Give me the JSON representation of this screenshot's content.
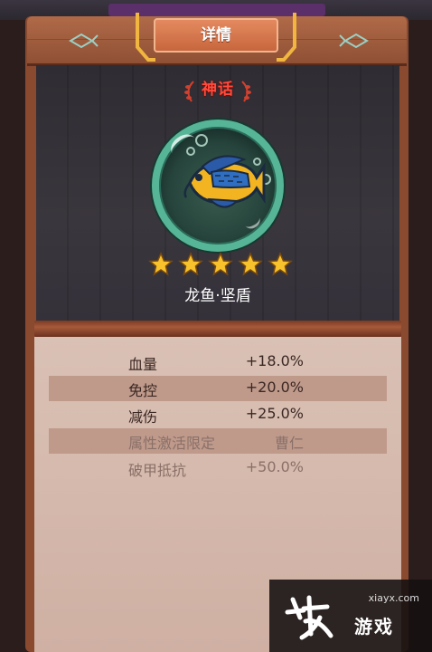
{
  "header": {
    "title": "详情"
  },
  "fish": {
    "rarity": "神话",
    "name": "龙鱼·坚盾",
    "stars": 5
  },
  "stats": [
    {
      "label": "血量",
      "value": "+18.0%",
      "dim": false,
      "band": false
    },
    {
      "label": "免控",
      "value": "+20.0%",
      "dim": false,
      "band": true
    },
    {
      "label": "减伤",
      "value": "+25.0%",
      "dim": false,
      "band": false
    },
    {
      "label": "属性激活限定",
      "value": "曹仁",
      "dim": true,
      "band": true
    },
    {
      "label": "破甲抵抗",
      "value": "+50.0%",
      "dim": true,
      "band": false
    }
  ],
  "watermark": {
    "url": "xiayx.com",
    "brand": "游戏"
  },
  "colors": {
    "rarity": "#ff4a3c",
    "panel": "#8a4a30",
    "orb_ring": "#56b596"
  }
}
